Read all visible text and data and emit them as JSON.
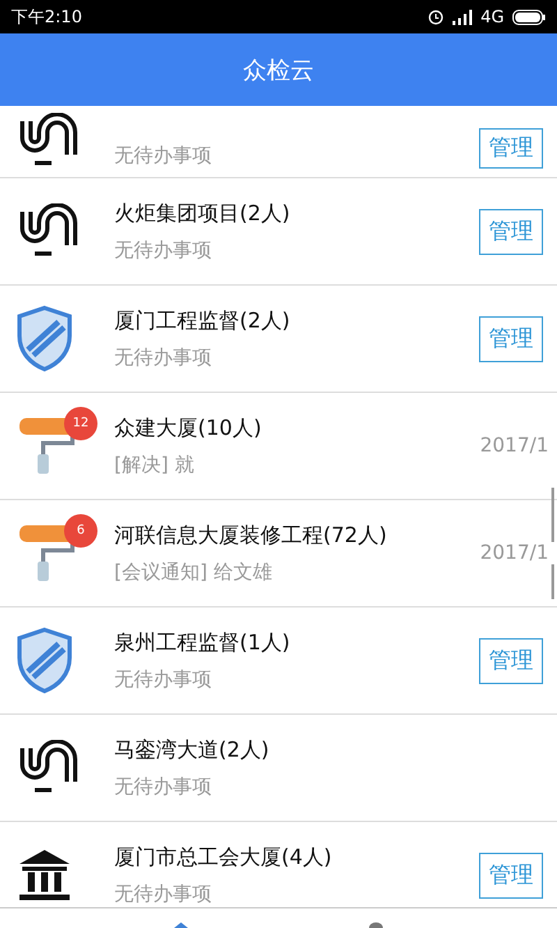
{
  "status_bar": {
    "time": "下午2:10",
    "network": "4G"
  },
  "header": {
    "title": "众检云"
  },
  "items": [
    {
      "kind": "loop",
      "subtitle": "无待办事项",
      "action": "管理",
      "clipped": true
    },
    {
      "kind": "loop",
      "title": "火炬集团项目(2人)",
      "subtitle": "无待办事项",
      "action": "管理"
    },
    {
      "kind": "shield",
      "title": "厦门工程监督(2人)",
      "subtitle": "无待办事项",
      "action": "管理"
    },
    {
      "kind": "roller",
      "badge": "12",
      "title": "众建大厦(10人)",
      "subtitle": "[解决] 就",
      "date": "2017/1"
    },
    {
      "kind": "roller",
      "badge": "6",
      "title": "河联信息大厦装修工程(72人)",
      "subtitle": "[会议通知] 给文雄",
      "date": "2017/1"
    },
    {
      "kind": "shield",
      "title": "泉州工程监督(1人)",
      "subtitle": "无待办事项",
      "action": "管理"
    },
    {
      "kind": "loop",
      "title": "马銮湾大道(2人)",
      "subtitle": "无待办事项"
    },
    {
      "kind": "bank",
      "title": "厦门市总工会大厦(4人)",
      "subtitle": "无待办事项",
      "action": "管理"
    }
  ]
}
